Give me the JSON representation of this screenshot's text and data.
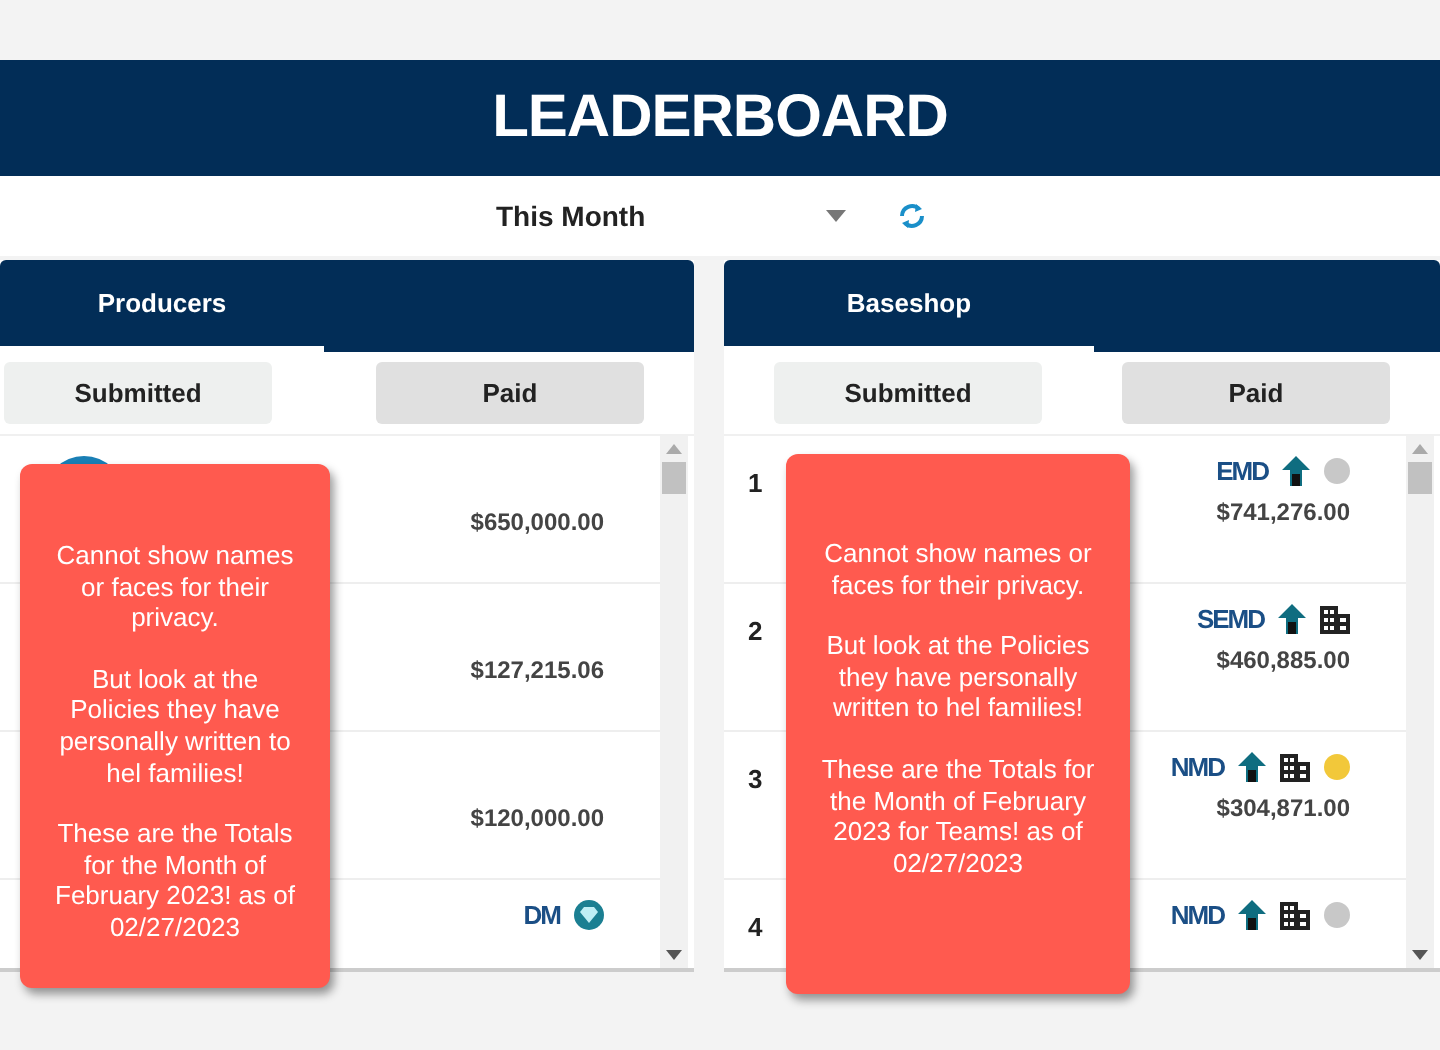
{
  "header": {
    "title": "LEADERBOARD"
  },
  "filter": {
    "value": "This Month"
  },
  "panels": [
    {
      "tab": {
        "label": "Producers",
        "selected": true
      },
      "toggles": [
        {
          "label": "Submitted",
          "selected": false
        },
        {
          "label": "Paid",
          "selected": true
        }
      ],
      "rows": [
        {
          "avatar": true,
          "amount": "$650,000.00",
          "icons": []
        },
        {
          "amount": "$127,215.06",
          "icons": []
        },
        {
          "amount": "$120,000.00",
          "icons": []
        },
        {
          "badge": "DM",
          "icons": [
            {
              "kind": "gem"
            }
          ]
        }
      ],
      "note": [
        "Cannot show names or faces for their privacy.",
        "But look at the Policies they have personally written to hel families!",
        "These are the Totals for the Month of February 2023!  as of 02/27/2023"
      ]
    },
    {
      "tab": {
        "label": "Baseshop",
        "selected": true
      },
      "toggles": [
        {
          "label": "Submitted",
          "selected": false
        },
        {
          "label": "Paid",
          "selected": true
        }
      ],
      "rows": [
        {
          "rank": "1",
          "badge": "EMD",
          "amount": "$741,276.00",
          "icons": [
            {
              "kind": "arrow"
            },
            {
              "kind": "coin",
              "color": "#c8c8c8"
            }
          ]
        },
        {
          "rank": "2",
          "badge": "SEMD",
          "amount": "$460,885.00",
          "icons": [
            {
              "kind": "arrow"
            },
            {
              "kind": "building"
            }
          ]
        },
        {
          "rank": "3",
          "badge": "NMD",
          "amount": "$304,871.00",
          "icons": [
            {
              "kind": "arrow"
            },
            {
              "kind": "building"
            },
            {
              "kind": "coin",
              "color": "#f2c83a"
            }
          ]
        },
        {
          "rank": "4",
          "badge": "NMD",
          "icons": [
            {
              "kind": "arrow"
            },
            {
              "kind": "building"
            },
            {
              "kind": "coin",
              "color": "#c8c8c8"
            }
          ]
        }
      ],
      "note": [
        "Cannot show names or faces for their privacy.",
        "But look at the Policies they have personally written to hel families!",
        "These are the Totals for the Month of February 2023 for Teams! as of 02/27/2023"
      ]
    }
  ]
}
